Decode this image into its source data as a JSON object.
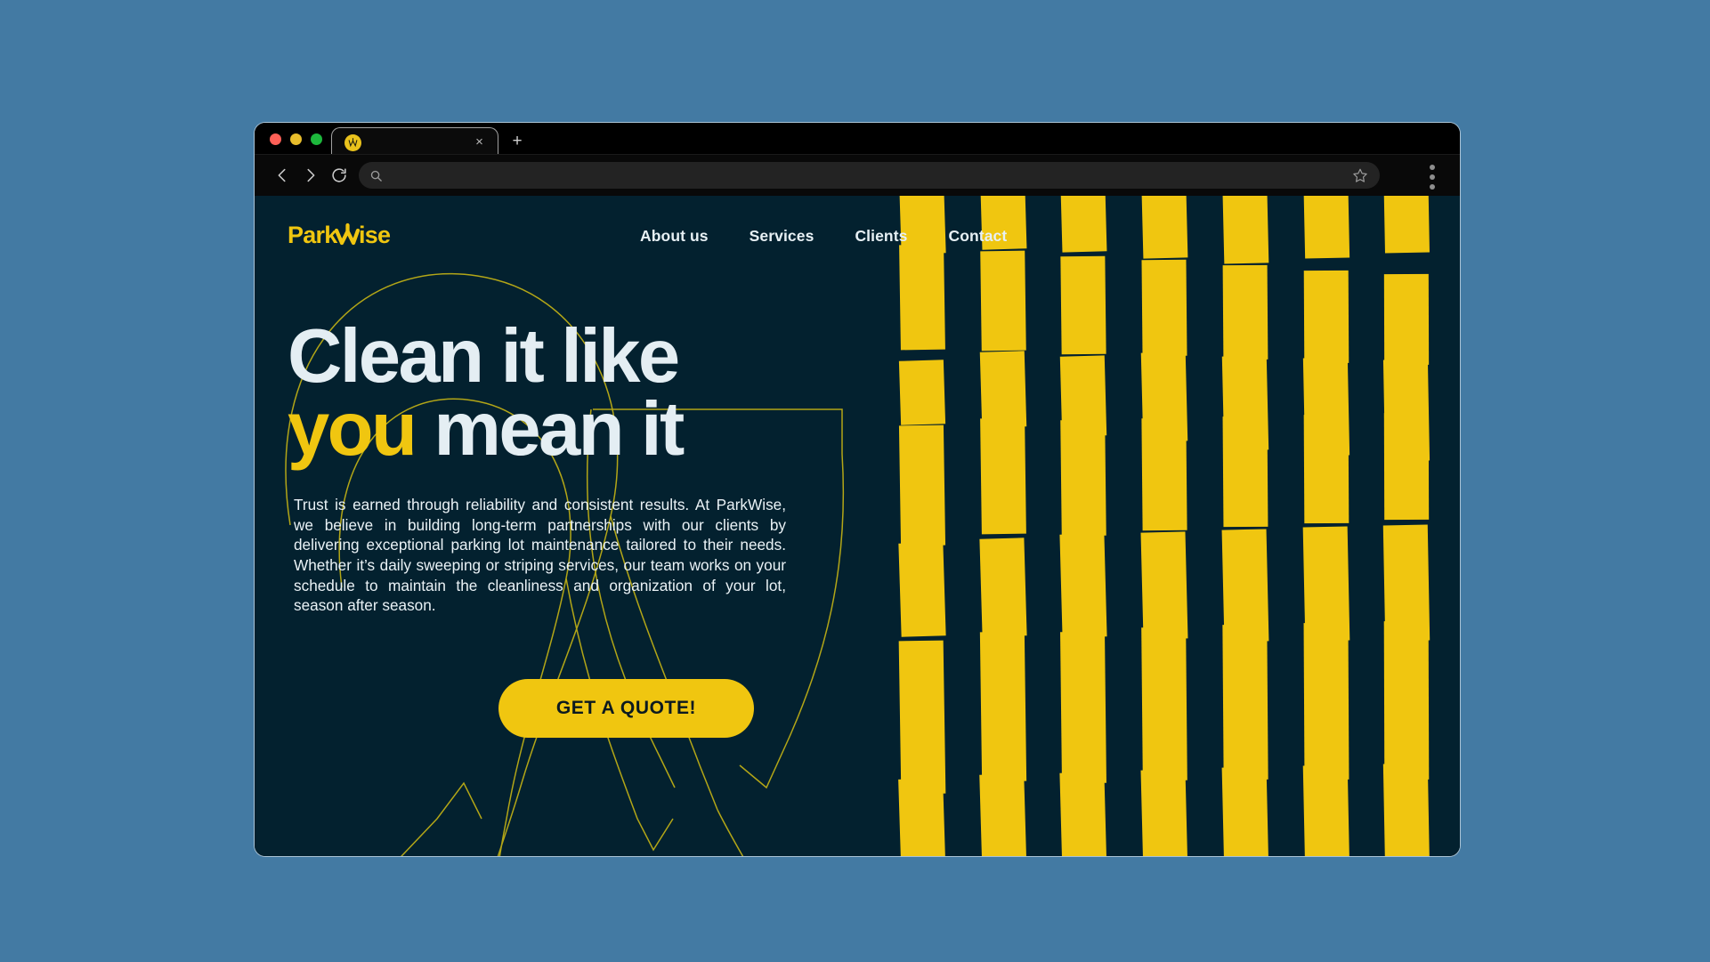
{
  "colors": {
    "page_background": "#437aa3",
    "site_background": "#03212f",
    "accent_yellow": "#f0c610",
    "text_light": "#e4eef3",
    "chrome_black": "#000000"
  },
  "browser": {
    "tab": {
      "title": "",
      "favicon": "parkwise-logo-favicon",
      "close_label": "×"
    },
    "new_tab_label": "+",
    "toolbar": {
      "back_icon": "chevron-left-icon",
      "forward_icon": "chevron-right-icon",
      "reload_icon": "reload-icon",
      "search_icon": "search-icon",
      "url_value": "",
      "url_placeholder": "",
      "bookmark_icon": "star-icon",
      "menu_icon": "three-dot-menu-icon"
    },
    "traffic_lights": [
      {
        "name": "close",
        "color": "#ff6057"
      },
      {
        "name": "minimize",
        "color": "#e8bd2b"
      },
      {
        "name": "maximize",
        "color": "#1db83c"
      }
    ]
  },
  "site": {
    "brand": {
      "name": "ParkWise",
      "part_one": "Park",
      "part_two": "Wise"
    },
    "nav": [
      {
        "label": "About us",
        "name": "about-us"
      },
      {
        "label": "Services",
        "name": "services"
      },
      {
        "label": "Clients",
        "name": "clients"
      },
      {
        "label": "Contact",
        "name": "contact"
      }
    ],
    "hero": {
      "headline_line1": "Clean it like",
      "headline_accent": "you",
      "headline_line2_rest": " mean it",
      "paragraph": "Trust is earned through reliability and consistent results. At ParkWise, we believe in building long-term partnerships with our clients by delivering exceptional parking lot maintenance tailored to their needs. Whether it’s daily sweeping or striping services, our team works on your schedule to maintain the cleanliness and organization of your lot, season after season.",
      "cta_label": "GET A QUOTE!"
    },
    "decor": {
      "stripe_pattern_name": "parking-stripes-pattern",
      "outline_name": "parkwise-outline-lines"
    }
  }
}
